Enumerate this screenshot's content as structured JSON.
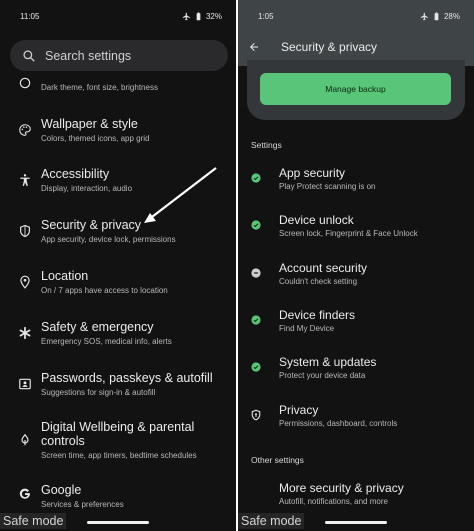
{
  "colors": {
    "background": "#121212",
    "accent_green": "#59c579",
    "appbar": "#3f4446",
    "search_bg": "#2a2a2d"
  },
  "left": {
    "status": {
      "time": "11:05",
      "battery": "32%"
    },
    "search": {
      "placeholder": "Search settings",
      "icon": "search-icon"
    },
    "items": [
      {
        "icon": "display-icon",
        "title": "",
        "subtitle": "Dark theme, font size, brightness"
      },
      {
        "icon": "palette-icon",
        "title": "Wallpaper & style",
        "subtitle": "Colors, themed icons, app grid"
      },
      {
        "icon": "accessibility-icon",
        "title": "Accessibility",
        "subtitle": "Display, interaction, audio"
      },
      {
        "icon": "shield-icon",
        "title": "Security & privacy",
        "subtitle": "App security, device lock, permissions"
      },
      {
        "icon": "location-pin-icon",
        "title": "Location",
        "subtitle": "On / 7 apps have access to location"
      },
      {
        "icon": "asterisk-icon",
        "title": "Safety & emergency",
        "subtitle": "Emergency SOS, medical info, alerts"
      },
      {
        "icon": "id-card-icon",
        "title": "Passwords, passkeys & autofill",
        "subtitle": "Suggestions for sign-in & autofill"
      },
      {
        "icon": "wellbeing-icon",
        "title": "Digital Wellbeing & parental controls",
        "title_line1": "Digital Wellbeing & parental",
        "title_line2": "controls",
        "subtitle": "Screen time, app timers, bedtime schedules"
      },
      {
        "icon": "google-icon",
        "title": "Google",
        "subtitle": "Services & preferences"
      }
    ],
    "safe_mode": "Safe mode"
  },
  "right": {
    "status": {
      "time": "1:05",
      "battery": "28%"
    },
    "title": "Security & privacy",
    "manage_backup": "Manage backup",
    "section_settings": "Settings",
    "items": [
      {
        "icon": "check-circle-icon",
        "status": "ok",
        "title": "App security",
        "subtitle": "Play Protect scanning is on"
      },
      {
        "icon": "check-circle-icon",
        "status": "ok",
        "title": "Device unlock",
        "subtitle": "Screen lock, Fingerprint & Face Unlock"
      },
      {
        "icon": "minus-circle-icon",
        "status": "neutral",
        "title": "Account security",
        "subtitle": "Couldn't check setting"
      },
      {
        "icon": "check-circle-icon",
        "status": "ok",
        "title": "Device finders",
        "subtitle": "Find My Device"
      },
      {
        "icon": "check-circle-icon",
        "status": "ok",
        "title": "System & updates",
        "subtitle": "Protect your device data"
      },
      {
        "icon": "shield-icon",
        "status": "none",
        "title": "Privacy",
        "subtitle": "Permissions, dashboard, controls"
      }
    ],
    "section_other": "Other settings",
    "other_items": [
      {
        "title": "More security & privacy",
        "subtitle": "Autofill, notifications, and more"
      }
    ],
    "safe_mode": "Safe mode"
  }
}
